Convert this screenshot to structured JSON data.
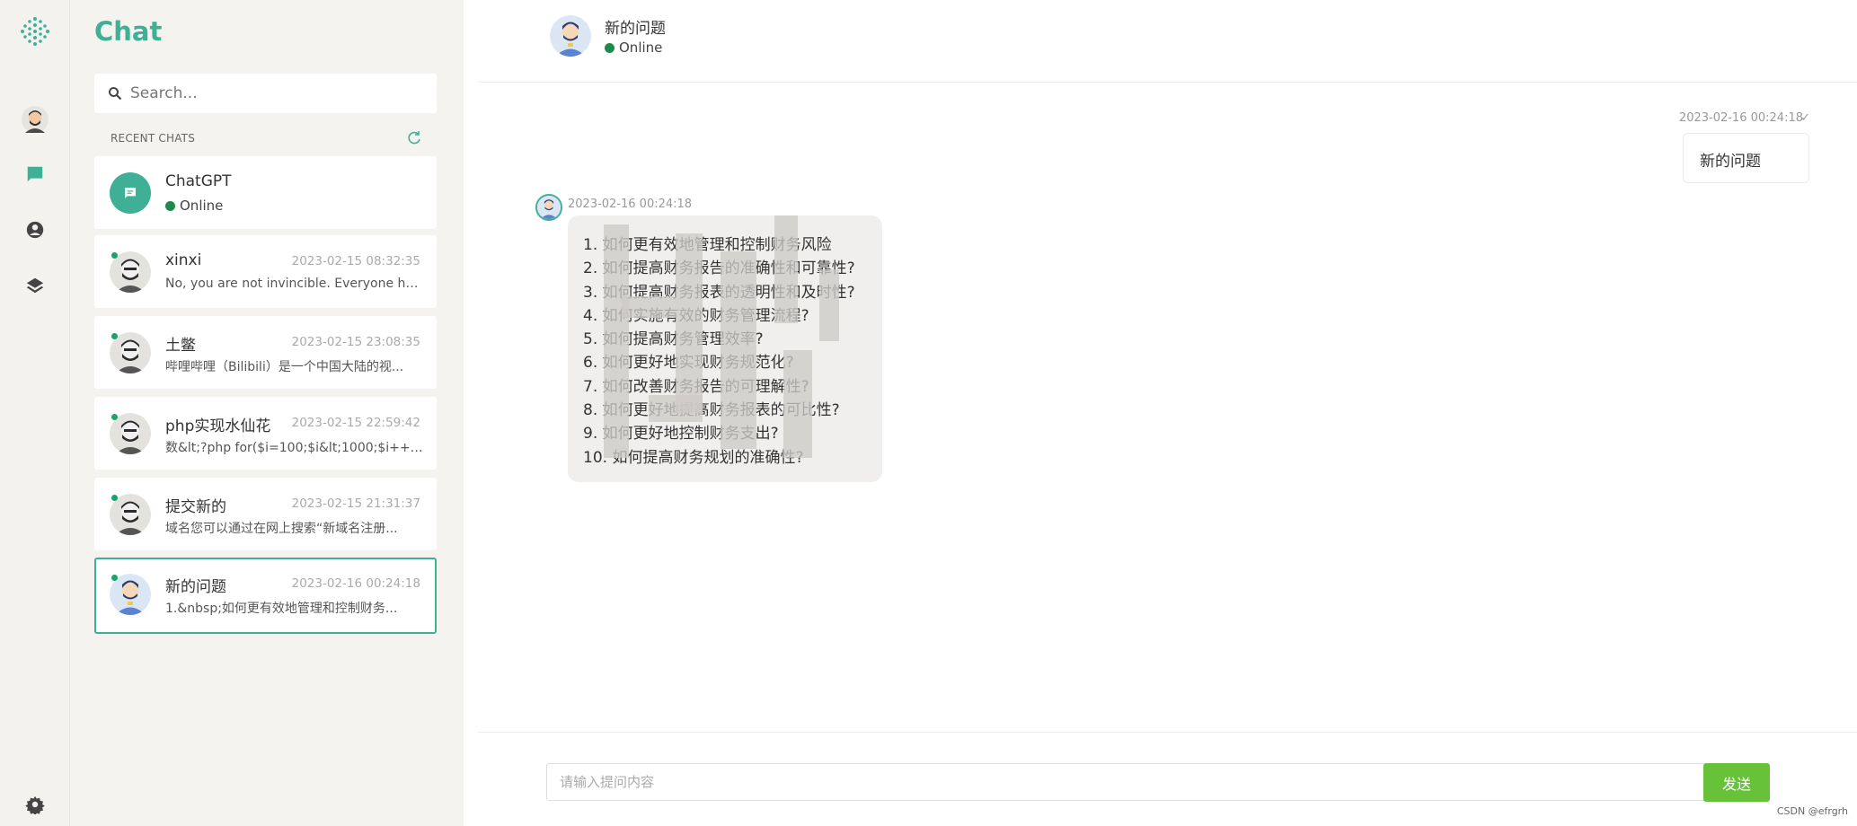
{
  "sidebar_title": "Chat",
  "search": {
    "placeholder": "Search..."
  },
  "recent_label": "RECENT CHATS",
  "chats": [
    {
      "name": "ChatGPT",
      "status": "Online",
      "time": "",
      "preview": ""
    },
    {
      "name": "xinxi",
      "time": "2023-02-15 08:32:35",
      "preview": "No, you are not invincible. Everyone has..."
    },
    {
      "name": "土鳖",
      "time": "2023-02-15 23:08:35",
      "preview": "哔哩哔哩（Bilibili）是一个中国大陆的视..."
    },
    {
      "name": "php实现水仙花",
      "time": "2023-02-15 22:59:42",
      "preview": "数&lt;?php for($i=100;$i&lt;1000;$i++)..."
    },
    {
      "name": "提交新的",
      "time": "2023-02-15 21:31:37",
      "preview": "域名您可以通过在网上搜索“新域名注册..."
    },
    {
      "name": "新的问题",
      "time": "2023-02-16 00:24:18",
      "preview": "1.&nbsp;如何更有效地管理和控制财务..."
    }
  ],
  "header": {
    "title": "新的问题",
    "status": "Online"
  },
  "messages": {
    "outgoing": {
      "time": "2023-02-16 00:24:18",
      "text": "新的问题"
    },
    "incoming": {
      "time": "2023-02-16 00:24:18",
      "lines": [
        "1. 如何更有效地管理和控制财务风险",
        "2. 如何提高财务报告的准确性和可靠性?",
        "3. 如何提高财务报表的透明性和及时性?",
        "4. 如何实施有效的财务管理流程?",
        "5. 如何提高财务管理效率?",
        "6. 如何更好地实现财务规范化?",
        "7. 如何改善财务报告的可理解性?",
        "8. 如何更好地提高财务报表的可比性?",
        "9. 如何更好地控制财务支出?",
        "10. 如何提高财务规划的准确性?"
      ]
    }
  },
  "composer": {
    "placeholder": "请输入提问内容",
    "send_label": "发送"
  },
  "watermark": "CSDN @efrgrh",
  "colors": {
    "accent": "#3fb096",
    "online": "#1e8a4c",
    "send": "#67c23a"
  },
  "icons": [
    "logo-icon",
    "user-avatar-icon",
    "chat-icon",
    "profile-icon",
    "layers-icon",
    "settings-icon",
    "search-icon",
    "refresh-icon",
    "emoji-icon",
    "check-icon"
  ]
}
